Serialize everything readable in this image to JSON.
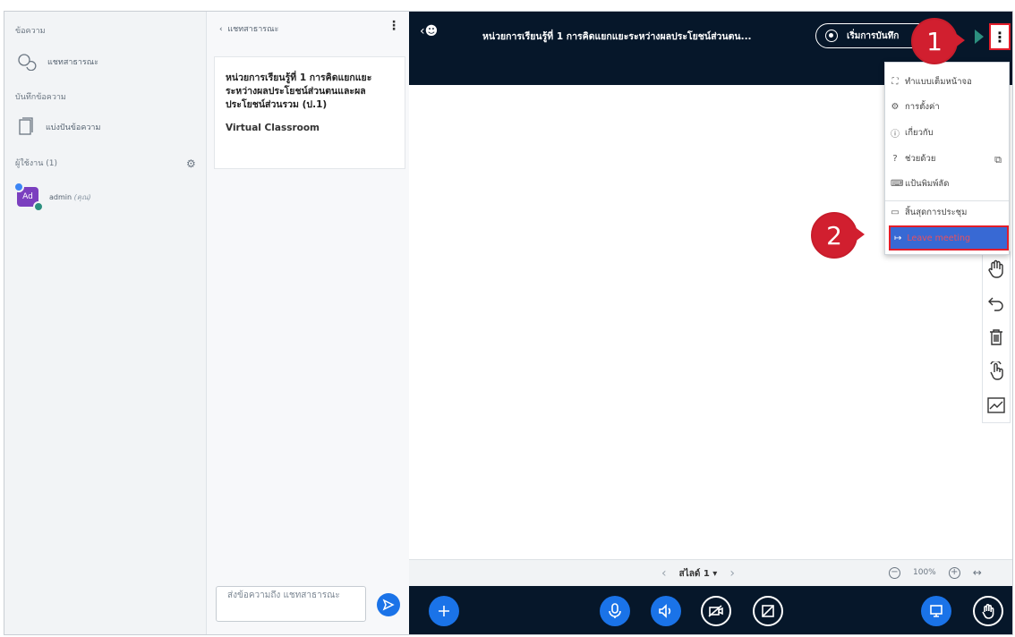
{
  "sidebar": {
    "messages_header": "ข้อความ",
    "public_chat": "แชทสาธารณะ",
    "notes_header": "บันทึกข้อความ",
    "shared_notes": "แบ่งปันข้อความ",
    "users_header": "ผู้ใช้งาน (1)",
    "user": {
      "avatar_text": "Ad",
      "name": "admin",
      "suffix": "(คุณ)"
    }
  },
  "chat": {
    "header": "แชทสาธารณะ",
    "welcome_title": "หน่วยการเรียนรู้ที่ 1 การคิดแยกแยะระหว่างผลประโยชน์ส่วนตนและผลประโยชน์ส่วนรวม (ป.1)",
    "welcome_sub": "Virtual Classroom",
    "input_placeholder": "ส่งข้อความถึง แชทสาธารณะ"
  },
  "topbar": {
    "title": "หน่วยการเรียนรู้ที่ 1 การคิดแยกแยะระหว่างผลประโยชน์ส่วนตน...",
    "record_label": "เริ่มการบันทึก"
  },
  "menu": {
    "items": [
      {
        "icon": "⛶",
        "label": "ทำแบบเต็มหน้าจอ"
      },
      {
        "icon": "⚙",
        "label": "การตั้งค่า"
      },
      {
        "icon": "ⓘ",
        "label": "เกี่ยวกับ"
      },
      {
        "icon": "?",
        "label": "ช่วยด้วย"
      },
      {
        "icon": "⌨",
        "label": "แป้นพิมพ์ลัด"
      },
      {
        "icon": "▭",
        "label": "สิ้นสุดการประชุม"
      }
    ],
    "leave_label": "Leave meeting"
  },
  "slidebar": {
    "slide_label": "สไลด์ 1",
    "zoom_level": "100%"
  },
  "badges": {
    "step1": "1",
    "step2": "2"
  },
  "colors": {
    "topbar_bg": "#06172a",
    "accent_blue": "#1a73e8",
    "highlight_red": "#e21d2a",
    "badge_red": "#d11f2f",
    "leave_bg": "#3869d4"
  }
}
